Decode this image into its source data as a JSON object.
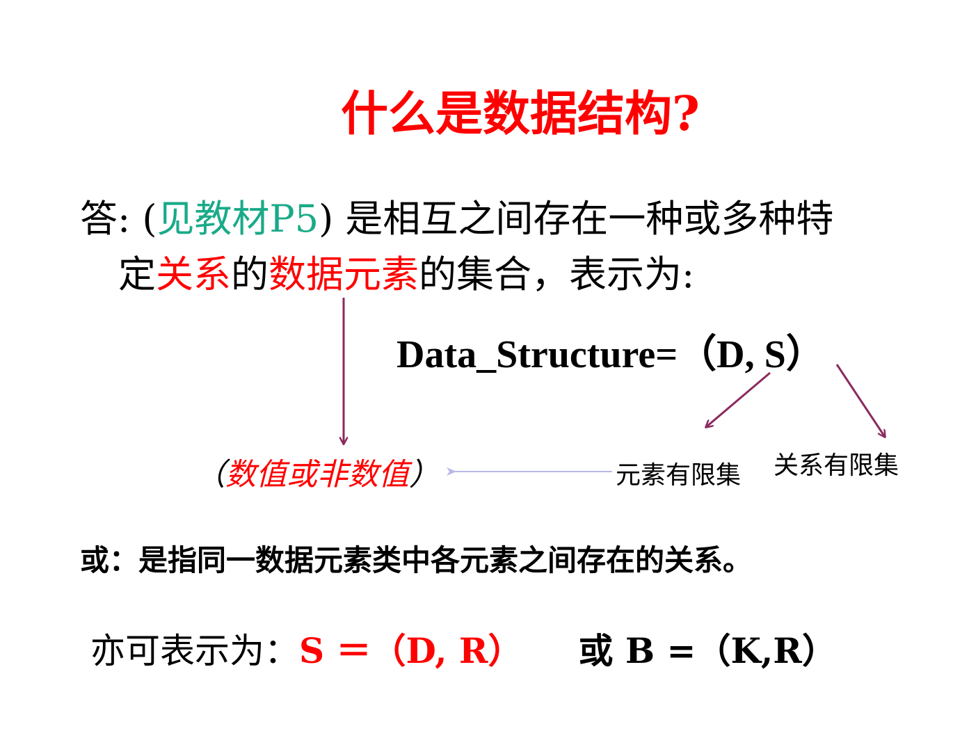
{
  "title": "什么是数据结构?",
  "definition": {
    "answer_prefix": "答: (",
    "reference": "见教材P5",
    "answer_close": ") 是相互之间存在一种或多种特",
    "line2_a": "定",
    "relation": "关系",
    "line2_b": "的",
    "data_elements": "数据元素",
    "line2_c": "的集合，表示为:"
  },
  "formula": "Data_Structure=（D, S）",
  "annotations": {
    "numeric_open": "（",
    "numeric": "数值或非数值",
    "numeric_close": "）",
    "element_set": "元素有限集",
    "relation_set": "关系有限集"
  },
  "alt_definition": "或：是指同一数据元素类中各元素之间存在的关系。",
  "alt_representation": {
    "prefix": "亦可表示为：",
    "formula_s": "S ＝（D, R）",
    "or_text": "或 B =（K,R）"
  },
  "colors": {
    "title": "#ff0000",
    "reference": "#1aaa88",
    "highlight": "#ff0000",
    "arrow": "#8b2a5e",
    "light_arrow": "#b8b8e8"
  }
}
